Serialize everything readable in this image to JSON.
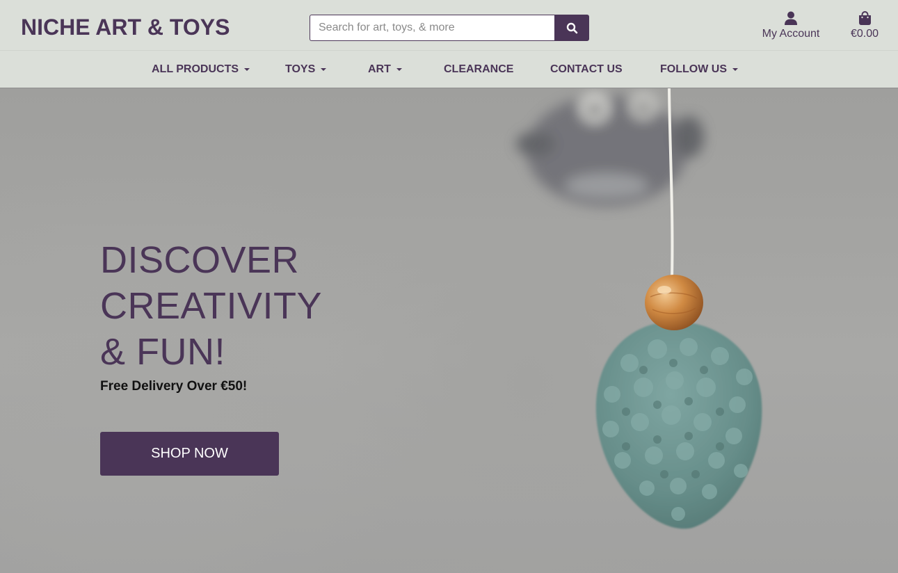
{
  "brand": {
    "name": "NICHE ART & TOYS"
  },
  "search": {
    "placeholder": "Search for art, toys, & more",
    "button_icon": "search-icon"
  },
  "account": {
    "label": "My Account",
    "icon": "user-icon"
  },
  "bag": {
    "total": "€0.00",
    "icon": "shopping-bag-icon"
  },
  "nav": {
    "items": [
      {
        "label": "ALL PRODUCTS",
        "dropdown": true
      },
      {
        "label": "TOYS",
        "dropdown": true
      },
      {
        "label": "ART",
        "dropdown": true
      },
      {
        "label": "CLEARANCE",
        "dropdown": false
      },
      {
        "label": "CONTACT US",
        "dropdown": false
      },
      {
        "label": "FOLLOW US",
        "dropdown": true
      }
    ]
  },
  "hero": {
    "headline": [
      "DISCOVER",
      "CREATIVITY",
      "& FUN!"
    ],
    "subline": "Free Delivery Over €50!",
    "cta": "SHOP NOW"
  },
  "colors": {
    "brand": "#4a3557",
    "header_bg": "#dbdfd9",
    "hero_bg": "#a6a6a4",
    "crochet": "#6e9490",
    "bead": "#c47a35"
  }
}
